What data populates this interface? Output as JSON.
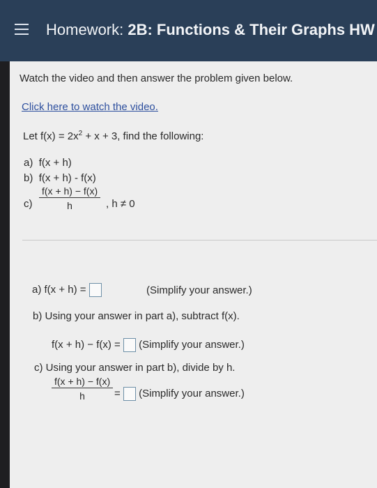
{
  "header": {
    "title_prefix": "Homework: ",
    "title_bold": "2B: Functions & Their Graphs HW"
  },
  "instructions": "Watch the video and then answer the problem given below.",
  "video_link": "Click here to watch the video.",
  "problem": {
    "lead": "Let f(x) = 2x",
    "exponent": "2",
    "tail": " + x + 3, find the following:",
    "items": [
      {
        "label": "a)",
        "text": "f(x + h)"
      },
      {
        "label": "b)",
        "text": "f(x + h) - f(x)"
      },
      {
        "label": "c)",
        "numerator": "f(x + h) − f(x)",
        "denominator": "h",
        "condition": ", h ≠ 0"
      }
    ]
  },
  "answers": {
    "a": {
      "prompt": "a)  f(x + h) =",
      "hint": "(Simplify your answer.)"
    },
    "b": {
      "instruction": "b) Using your answer in part a), subtract f(x).",
      "prompt": "f(x + h) − f(x) =",
      "hint": "(Simplify your answer.)"
    },
    "c": {
      "instruction": "c) Using your answer in part b), divide by h.",
      "numerator": "f(x + h) − f(x)",
      "denominator": "h",
      "equals": "=",
      "hint": "(Simplify your answer.)"
    }
  },
  "colors": {
    "header_bg": "#2a3f58",
    "link": "#2d4f9e",
    "content_bg": "#eeeeee"
  }
}
